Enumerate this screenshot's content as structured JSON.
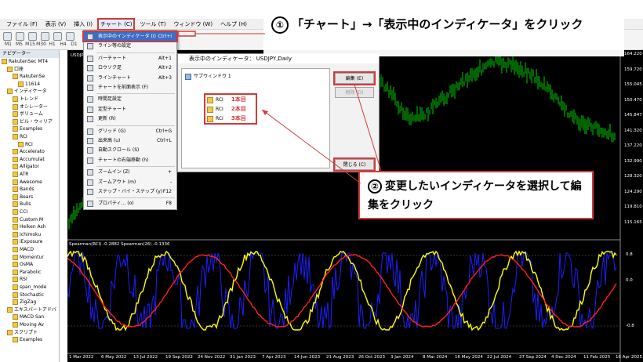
{
  "menubar": {
    "items": [
      "ファイル (F)",
      "表示 (V)",
      "挿入 (I)",
      "チャート (C)",
      "ツール (T)",
      "ウィンドウ (W)",
      "ヘルプ (H)"
    ]
  },
  "toolbar": {
    "timeframes": [
      "M1",
      "M5",
      "M15",
      "M30",
      "H1",
      "H4",
      "D1"
    ]
  },
  "navigator": {
    "title": "ナビゲーター",
    "items": [
      {
        "label": "RakutenSec MT4",
        "indent": 0
      },
      {
        "label": "口座",
        "indent": 1
      },
      {
        "label": "RakutenSe",
        "indent": 2
      },
      {
        "label": "11614",
        "indent": 3
      },
      {
        "label": "インディケータ",
        "indent": 1
      },
      {
        "label": "トレンド",
        "indent": 2
      },
      {
        "label": "オシレーター",
        "indent": 2
      },
      {
        "label": "ボリューム",
        "indent": 2
      },
      {
        "label": "ビル・ウィリア",
        "indent": 2
      },
      {
        "label": "Examples",
        "indent": 2
      },
      {
        "label": "RCI",
        "indent": 2
      },
      {
        "label": "RCI",
        "indent": 3
      },
      {
        "label": "Accelerato",
        "indent": 2
      },
      {
        "label": "Accumulat",
        "indent": 2
      },
      {
        "label": "Alligator",
        "indent": 2
      },
      {
        "label": "ATR",
        "indent": 2
      },
      {
        "label": "Awesome",
        "indent": 2
      },
      {
        "label": "Bands",
        "indent": 2
      },
      {
        "label": "Bears",
        "indent": 2
      },
      {
        "label": "Bulls",
        "indent": 2
      },
      {
        "label": "CCI",
        "indent": 2
      },
      {
        "label": "Custom M",
        "indent": 2
      },
      {
        "label": "Heiken Ash",
        "indent": 2
      },
      {
        "label": "Ichimoku",
        "indent": 2
      },
      {
        "label": "iExposure",
        "indent": 2
      },
      {
        "label": "MACD",
        "indent": 2
      },
      {
        "label": "Momentur",
        "indent": 2
      },
      {
        "label": "OsMA",
        "indent": 2
      },
      {
        "label": "Parabolic",
        "indent": 2
      },
      {
        "label": "RSI",
        "indent": 2
      },
      {
        "label": "span_mode",
        "indent": 2
      },
      {
        "label": "Stochastic",
        "indent": 2
      },
      {
        "label": "ZigZag",
        "indent": 2
      },
      {
        "label": "エキスパートアドバ",
        "indent": 1
      },
      {
        "label": "MACD San",
        "indent": 2
      },
      {
        "label": "Moving Av",
        "indent": 2
      },
      {
        "label": "スクリプト",
        "indent": 1
      },
      {
        "label": "Examples",
        "indent": 2
      }
    ]
  },
  "chart_menu": {
    "items": [
      {
        "label": "表示中のインディケータ (I)",
        "shortcut": "Ctrl+I",
        "highlight": true
      },
      {
        "label": "ライン等の設定",
        "shortcut": "",
        "sep_after": true
      },
      {
        "label": "バーチャート",
        "shortcut": "Alt+1"
      },
      {
        "label": "ロウソク足",
        "shortcut": "Alt+2"
      },
      {
        "label": "ラインチャート",
        "shortcut": "Alt+3"
      },
      {
        "label": "チャートを前面表示 (F)",
        "shortcut": "",
        "sep_after": true
      },
      {
        "label": "時間足設定",
        "shortcut": ""
      },
      {
        "label": "定型チャート",
        "shortcut": ""
      },
      {
        "label": "更新 (R)",
        "shortcut": "",
        "sep_after": true
      },
      {
        "label": "グリッド (G)",
        "shortcut": "Ctrl+G"
      },
      {
        "label": "出来高 (u)",
        "shortcut": "Ctrl+L"
      },
      {
        "label": "自動スクロール (S)",
        "shortcut": ""
      },
      {
        "label": "チャートの右端移動 (h)",
        "shortcut": "",
        "sep_after": true
      },
      {
        "label": "ズームイン (Z)",
        "shortcut": "+"
      },
      {
        "label": "ズームアウト (m)",
        "shortcut": "-"
      },
      {
        "label": "ステップ・バイ・ステップ (y)",
        "shortcut": "F12",
        "sep_after": true
      },
      {
        "label": "プロパティ... (o)",
        "shortcut": "F8"
      }
    ]
  },
  "dialog": {
    "title": "表示中のインディケータ： USDJPY,Daily",
    "tree_root": "サブウィンドウ 1",
    "indicators": [
      {
        "name": "RCI",
        "note": "1本目"
      },
      {
        "name": "RCI",
        "note": "2本目"
      },
      {
        "name": "RCI",
        "note": "3本目"
      }
    ],
    "edit_button": "編集 (E)",
    "delete_button": "削除 (D)",
    "close_button": "閉じる (C)"
  },
  "annotations": {
    "step1_num": "①",
    "step1_text": "「チャート」→「表示中のインディケータ」をクリック",
    "step2_num": "②",
    "step2_text": "変更したいインディケータを選択して編集をクリック"
  },
  "chart_info": {
    "symbol": "USDJPY",
    "subwindow_label": "Spearman(RCI) -0.2882 Spearman(26) -0.1336",
    "price_ticks": [
      "164.220",
      "159.720",
      "155.045",
      "150.470",
      "145.847",
      "141.320",
      "137.220",
      "132.990",
      "128.320",
      "124.290",
      "119.810",
      "115.165"
    ],
    "osc_ticks": [
      "0.8",
      "0.0",
      "-0.8"
    ],
    "date_ticks": [
      "1 Mar 2022",
      "6 May 2022",
      "13 Jul 2022",
      "19 Sep 2022",
      "24 Nov 2022",
      "31 Jan 2023",
      "7 Apr 2023",
      "14 Jun 2023",
      "21 Aug 2023",
      "26 Oct 2023",
      "3 Jan 2024",
      "8 Mar 2024",
      "16 May 2024",
      "22 Jul 2024",
      "27 Sep 2024",
      "4 Dec 2024",
      "11 Feb 2025",
      "18 Apr 2025"
    ],
    "current_price": "145.847"
  }
}
